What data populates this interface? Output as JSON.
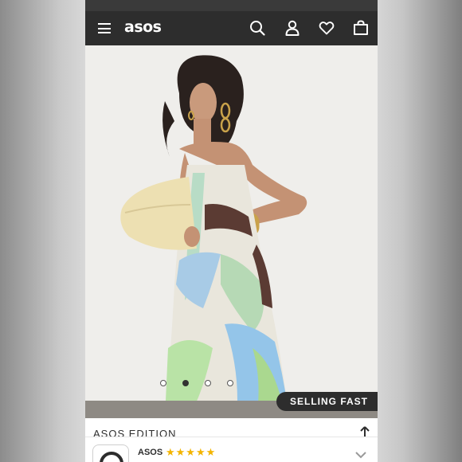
{
  "app": {
    "logo": "asos"
  },
  "header": {
    "icons": [
      "menu-icon",
      "search-icon",
      "account-icon",
      "heart-icon",
      "bag-icon"
    ]
  },
  "hero": {
    "badge": "SELLING FAST",
    "carousel": {
      "total": 4,
      "active_index": 1
    }
  },
  "product": {
    "title_partial": "ASOS EDITION"
  },
  "reviews": {
    "seller_name": "ASOS",
    "stars": "★★★★★",
    "star_color": "#f3b400"
  },
  "colors": {
    "header_bg": "#2d2d2d",
    "page_bg": "#ffffff"
  }
}
